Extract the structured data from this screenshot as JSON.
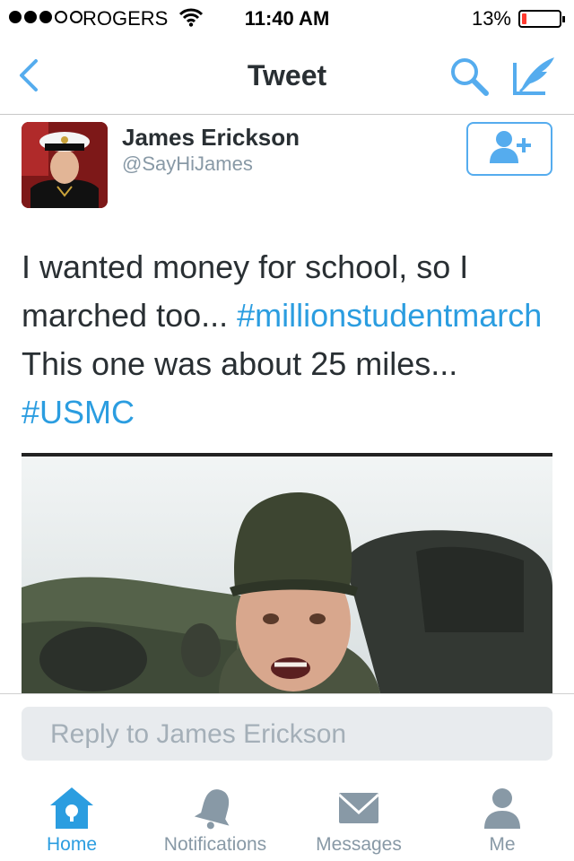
{
  "status_bar": {
    "carrier": "ROGERS",
    "time": "11:40 AM",
    "battery_percent": "13%",
    "battery_level": 0.13,
    "signal_bars_filled": 3,
    "signal_bars_total": 5
  },
  "nav": {
    "title": "Tweet",
    "back_icon": "chevron-left-icon",
    "search_icon": "search-icon",
    "compose_icon": "compose-quill-icon"
  },
  "tweet": {
    "author_name": "James Erickson",
    "author_handle": "@SayHiJames",
    "text_part1": "I wanted money for school, so I marched too... ",
    "hashtag1": "#millionstudentmarch",
    "text_part2": " This one was about 25 miles... ",
    "hashtag2": "#USMC",
    "follow_icon": "add-user-icon"
  },
  "reply": {
    "placeholder": "Reply to James Erickson"
  },
  "tabs": [
    {
      "label": "Home",
      "icon": "home-icon",
      "active": true
    },
    {
      "label": "Notifications",
      "icon": "bell-icon",
      "active": false
    },
    {
      "label": "Messages",
      "icon": "envelope-icon",
      "active": false
    },
    {
      "label": "Me",
      "icon": "person-icon",
      "active": false
    }
  ],
  "colors": {
    "accent": "#55acee",
    "hashtag": "#2b9de0",
    "text": "#292f33",
    "muted": "#8899a6",
    "battery_low": "#ff3b30"
  }
}
